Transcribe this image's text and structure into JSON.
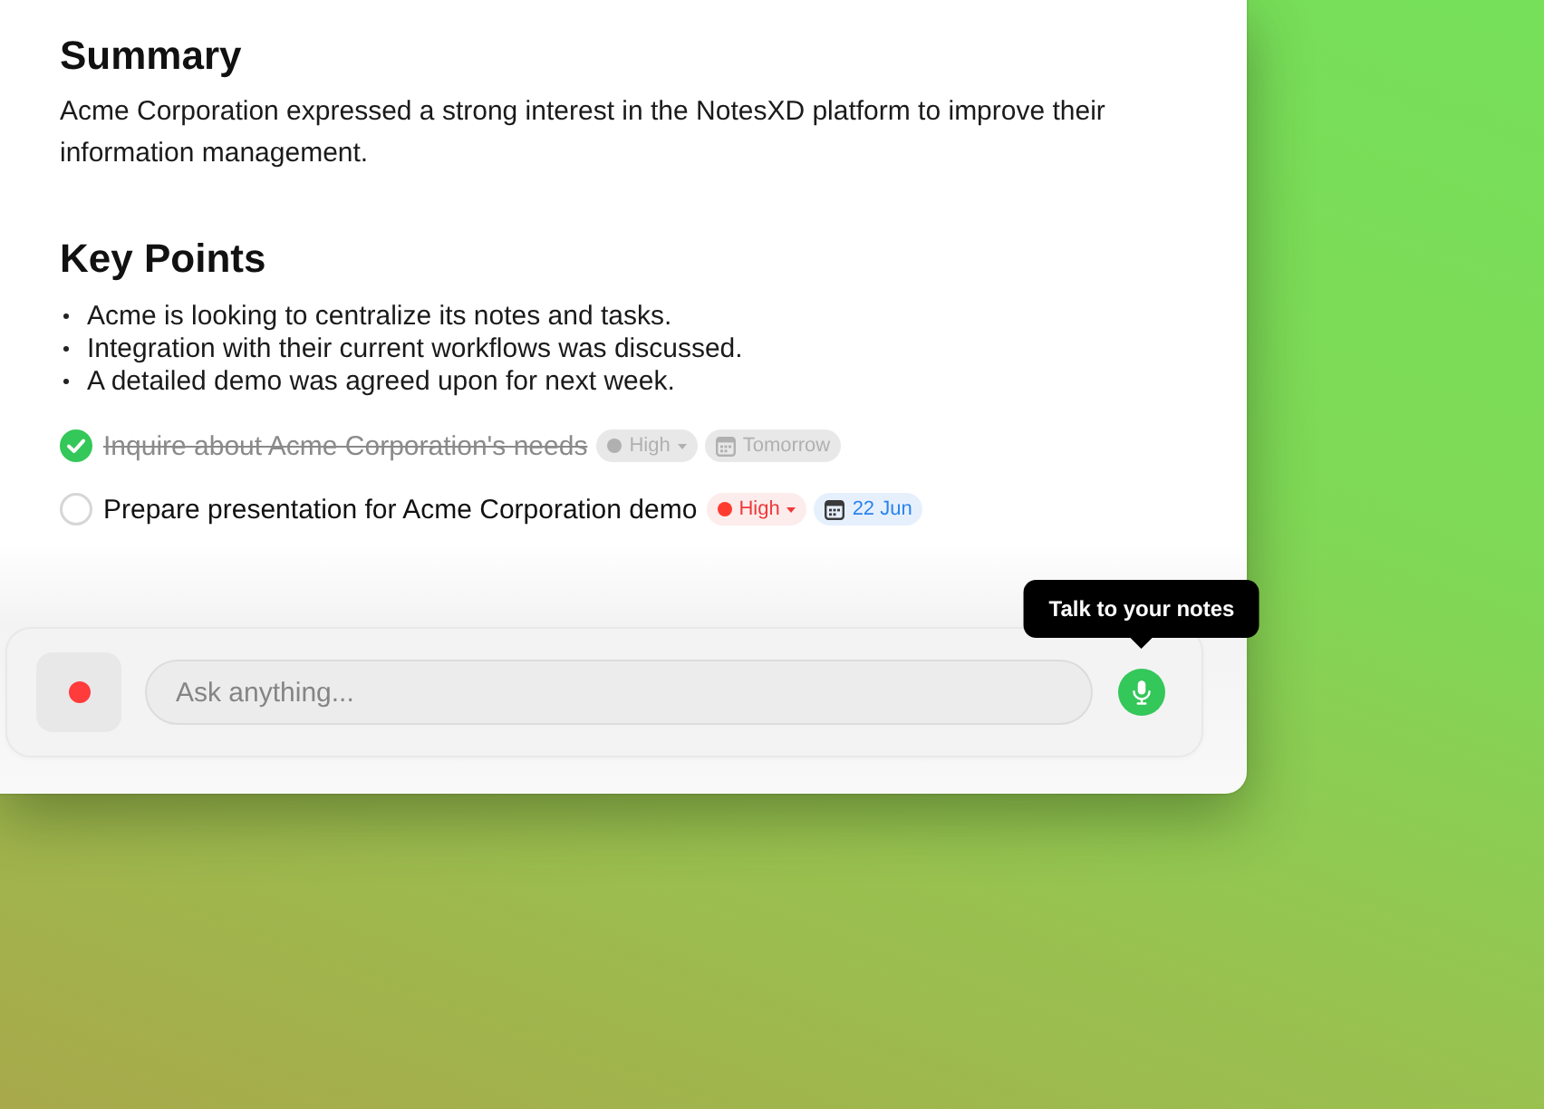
{
  "summary": {
    "heading": "Summary",
    "text": "Acme Corporation expressed a strong interest in the NotesXD platform to improve their information management."
  },
  "key_points": {
    "heading": "Key Points",
    "items": [
      "Acme is looking to centralize its notes and tasks.",
      "Integration with their current workflows was discussed.",
      "A detailed demo was agreed upon for next week."
    ]
  },
  "tasks": [
    {
      "title": "Inquire about Acme Corporation's needs",
      "checked": true,
      "priority": "High",
      "due": "Tomorrow"
    },
    {
      "title": "Prepare presentation for Acme Corporation demo",
      "checked": false,
      "priority": "High",
      "due": "22 Jun"
    }
  ],
  "composer": {
    "placeholder": "Ask anything...",
    "mic_tooltip": "Talk to your notes"
  }
}
